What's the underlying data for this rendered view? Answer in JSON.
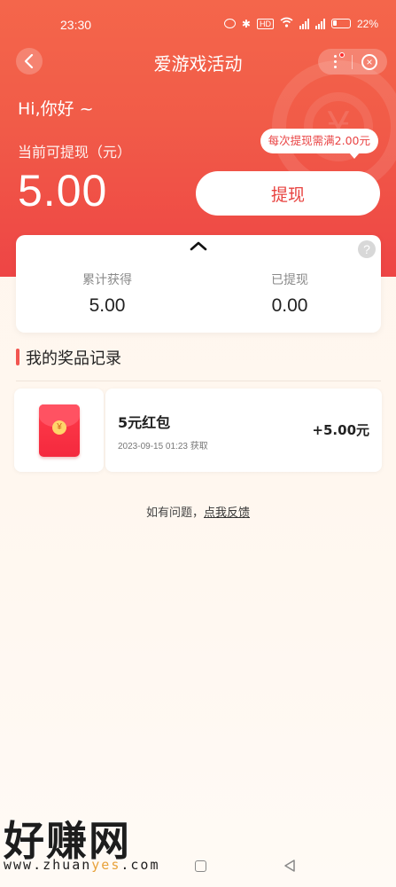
{
  "status_bar": {
    "time": "23:30",
    "battery": "22%",
    "icons": [
      "alarm-icon",
      "bluetooth-icon",
      "hd-icon",
      "wifi-icon",
      "signal-icon",
      "signal-icon",
      "battery-icon"
    ]
  },
  "nav": {
    "title": "爱游戏活动",
    "back_icon": "chevron-left-icon",
    "more_icon": "more-vertical-icon",
    "close_icon": "close-icon"
  },
  "hero": {
    "greeting": "Hi,你好 ~",
    "balance_label": "当前可提现（元）",
    "balance_value": "5.00",
    "tip": "每次提现需满2.00元",
    "withdraw_label": "提现"
  },
  "stats": {
    "earned_label": "累计获得",
    "earned_value": "5.00",
    "withdrawn_label": "已提现",
    "withdrawn_value": "0.00"
  },
  "records": {
    "section_title": "我的奖品记录",
    "items": [
      {
        "name": "5元红包",
        "date": "2023-09-15 01:23 获取",
        "amount": "+5.00元"
      }
    ]
  },
  "feedback": {
    "prefix": "如有问题，",
    "link": "点我反馈"
  },
  "watermark": {
    "brand": "好赚网",
    "url_prefix": "www.zhuan",
    "url_highlight": "yes",
    "url_suffix": ".com"
  },
  "colors": {
    "brand_red": "#f15b48",
    "accent_text": "#e8423f",
    "background": "#fff6ee"
  }
}
